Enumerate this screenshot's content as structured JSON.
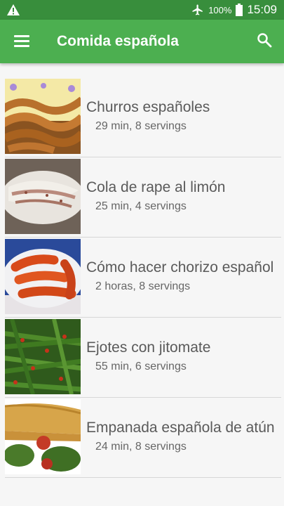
{
  "status_bar": {
    "battery": "100%",
    "time": "15:09",
    "warning_icon": "warning-icon",
    "airplane_icon": "airplane-mode-icon",
    "battery_icon": "battery-icon"
  },
  "app_bar": {
    "title": "Comida española",
    "menu_icon": "hamburger-menu-icon",
    "search_icon": "search-icon"
  },
  "recipes": [
    {
      "name": "Churros españoles",
      "meta": "29 min, 8 servings"
    },
    {
      "name": "Cola de rape al limón",
      "meta": "25 min, 4 servings"
    },
    {
      "name": "Cómo hacer chorizo español",
      "meta": "2 horas, 8 servings"
    },
    {
      "name": "Ejotes con jitomate",
      "meta": "55 min, 6 servings"
    },
    {
      "name": "Empanada española de atún",
      "meta": "24 min, 8 servings"
    }
  ],
  "colors": {
    "status_bar": "#388e3c",
    "app_bar": "#4caf50",
    "background": "#f6f6f6"
  }
}
